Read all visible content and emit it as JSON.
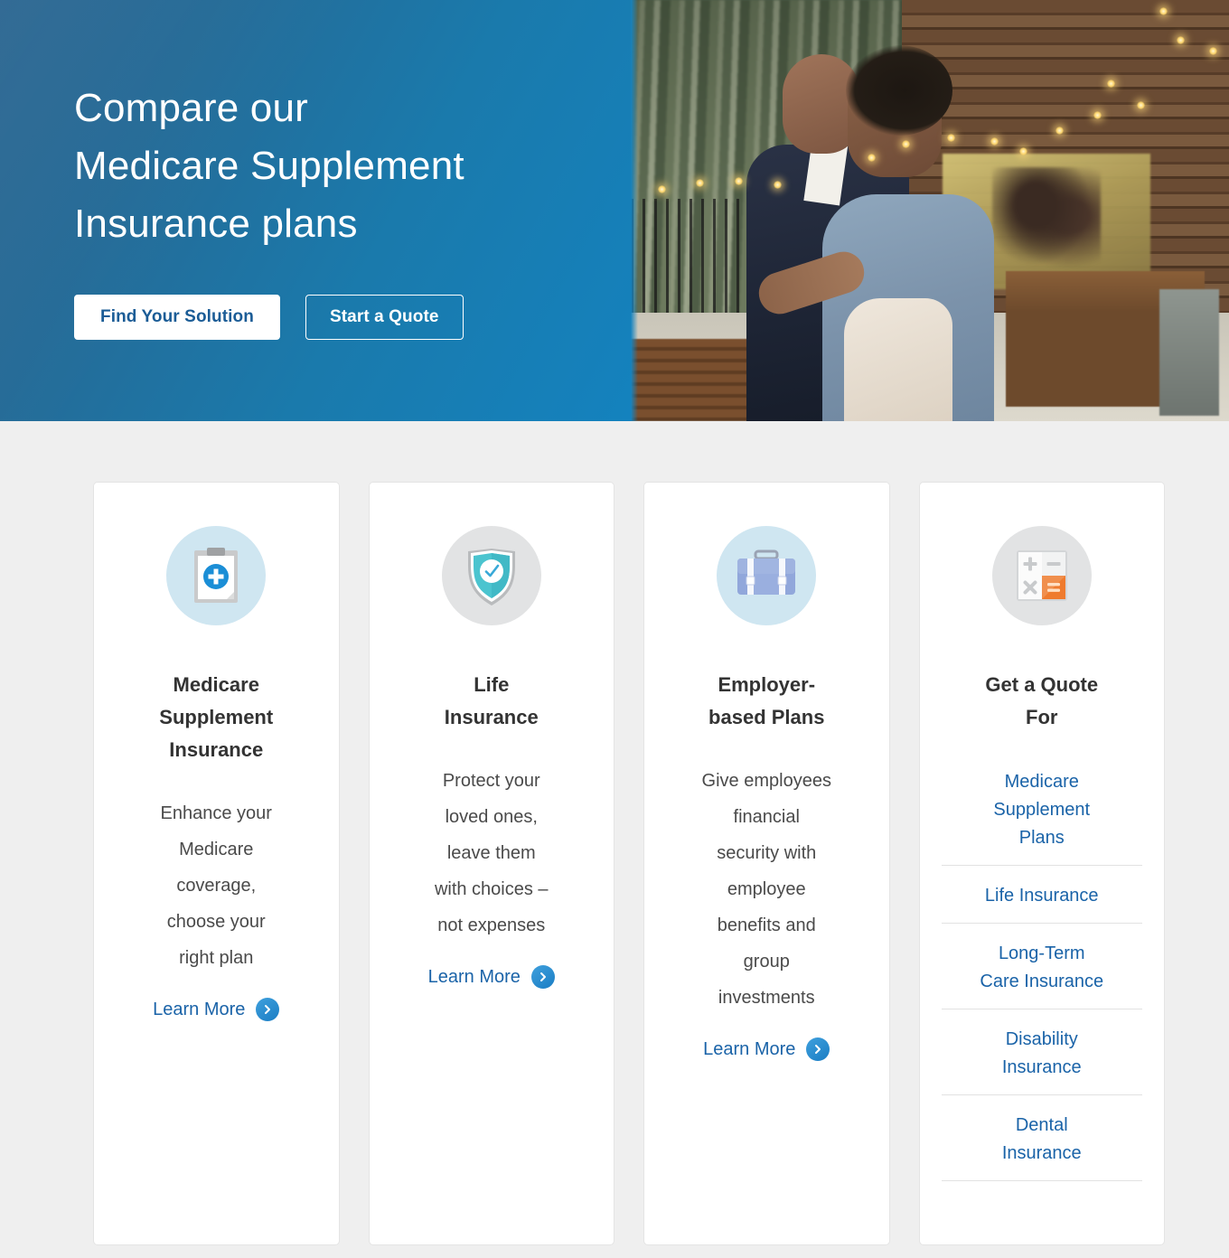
{
  "hero": {
    "title": "Compare our\nMedicare Supplement\nInsurance plans",
    "primary_button": "Find Your Solution",
    "secondary_button": "Start a Quote",
    "gradient_from": "#2c6691",
    "gradient_to": "#1482be",
    "photo_alt": "Smiling older couple dancing on a deck with string lights outside a cabin"
  },
  "cards": [
    {
      "icon": "clipboard-plus-icon",
      "icon_bg": "#cfe6f1",
      "title": "Medicare\nSupplement\nInsurance",
      "description": "Enhance your\nMedicare\ncoverage,\nchoose your\nright plan",
      "link_label": "Learn More"
    },
    {
      "icon": "shield-check-icon",
      "icon_bg": "#e2e3e4",
      "title": "Life\nInsurance",
      "description": "Protect your\nloved ones,\nleave them\nwith choices –\nnot expenses",
      "link_label": "Learn More"
    },
    {
      "icon": "briefcase-icon",
      "icon_bg": "#cfe6f1",
      "title": "Employer-\nbased Plans",
      "description": "Give employees\nfinancial\nsecurity with\nemployee\nbenefits and\ngroup\ninvestments",
      "link_label": "Learn More"
    },
    {
      "icon": "calculator-icon",
      "icon_bg": "#e2e3e4",
      "title": "Get a Quote\nFor",
      "links": [
        "Medicare\nSupplement\nPlans",
        "Life Insurance",
        "Long-Term\nCare Insurance",
        "Disability\nInsurance",
        "Dental\nInsurance"
      ]
    }
  ],
  "colors": {
    "link_blue": "#1a63a8",
    "button_text_blue": "#1b5c96",
    "page_background": "#efefef",
    "card_background": "#ffffff",
    "title_text": "#333333",
    "body_text": "#4a4a4a",
    "accent_orange": "#ef7b2e",
    "accent_teal": "#4bc4cf"
  }
}
